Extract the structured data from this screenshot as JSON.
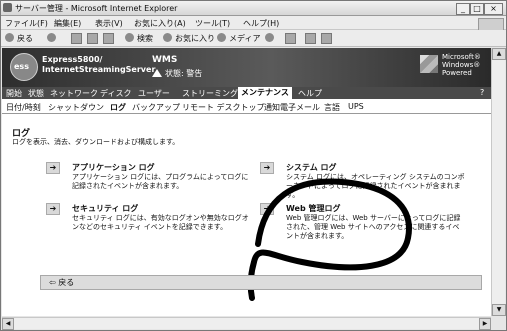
{
  "window": {
    "title": "サーバー管理 - Microsoft Internet Explorer",
    "buttons": {
      "minimize": "_",
      "maximize": "□",
      "close": "×"
    }
  },
  "menubar": {
    "items": [
      "ファイル(F)",
      "編集(E)",
      "表示(V)",
      "お気に入り(A)",
      "ツール(T)",
      "ヘルプ(H)"
    ]
  },
  "toolbar": {
    "back": "戻る",
    "search": "検索",
    "favorites": "お気に入り",
    "media": "メディア"
  },
  "banner": {
    "logo_text": "ess",
    "product_line1": "Express5800/",
    "product_line2": "InternetStreamingServer",
    "server_name": "WMS",
    "status": "状態: 警告",
    "windows_brand_line1": "Microsoft®",
    "windows_brand_line2": "Windows®",
    "windows_brand_line3": "Powered"
  },
  "nav": {
    "tabs": [
      "開始",
      "状態",
      "ネットワーク",
      "ディスク",
      "ユーザー",
      "ストリーミング",
      "メンテナンス",
      "ヘルプ"
    ],
    "active_index": 6,
    "help": "?"
  },
  "subnav": {
    "tabs": [
      "日付/時刻",
      "シャットダウン",
      "ログ",
      "バックアップ",
      "リモート デスクトップ",
      "通知電子メール",
      "言語",
      "UPS"
    ],
    "active_index": 2
  },
  "page": {
    "heading": "ログ",
    "description": "ログを表示、消去、ダウンロードおよび構成します。"
  },
  "items": [
    {
      "title": "アプリケーション ログ",
      "desc": "アプリケーション ログには、プログラムによってログに記録されたイベントが含まれます。"
    },
    {
      "title": "システム ログ",
      "desc": "システム ログには、オペレーティング システムのコンポーネントによってログに記録されたイベントが含まれます。"
    },
    {
      "title": "セキュリティ ログ",
      "desc": "セキュリティ ログには、有効なログオンや無効なログオンなどのセキュリティ イベントを記録できます。"
    },
    {
      "title": "Web 管理ログ",
      "desc": "Web 管理ログには、Web サーバーによってログに記録された、管理 Web サイトへのアクセスに関連するイベントが含まれます。"
    }
  ],
  "back_button": "戻る",
  "colors": {
    "banner_bg": "#3a3a3a",
    "nav_bg": "#4a4a4a",
    "backbar_bg": "#dcdcdc",
    "annotation": "#000000"
  },
  "icons": {
    "item_arrow": "arrow-right-icon",
    "back_arrow": "arrow-left-icon",
    "status": "warning-icon"
  }
}
